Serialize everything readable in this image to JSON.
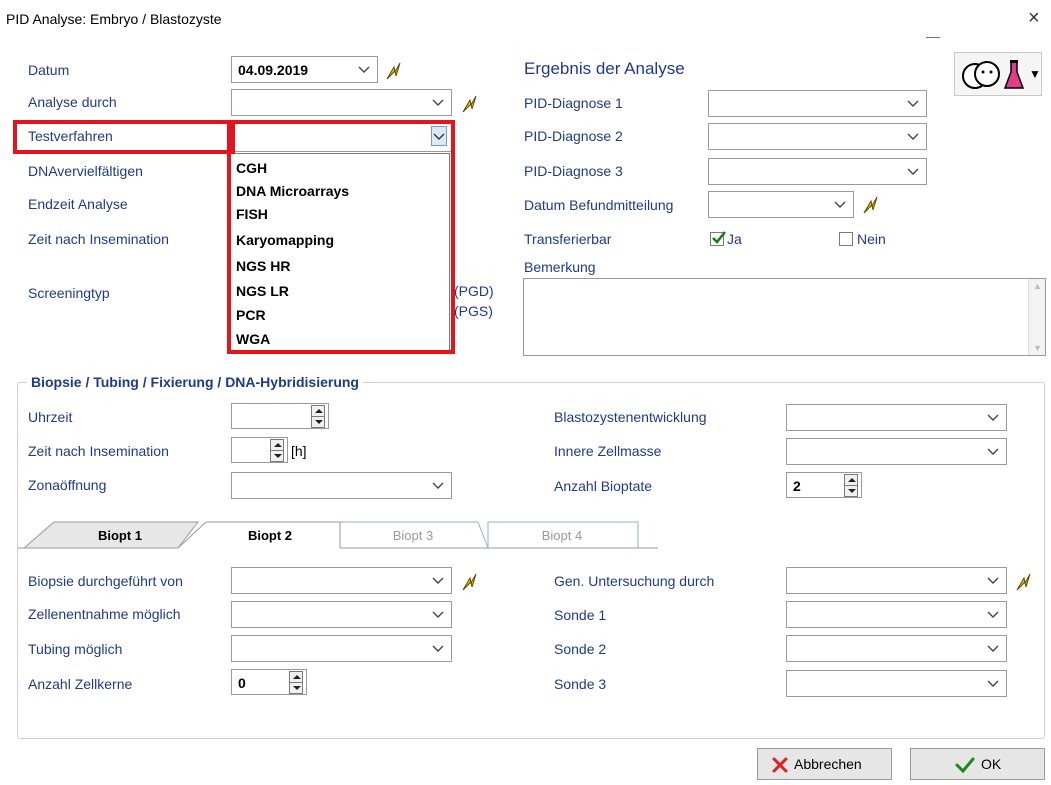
{
  "window": {
    "title": "PID Analyse: Embryo / Blastozyste",
    "close_glyph": "×",
    "minimize_glyph": "—"
  },
  "top_left": {
    "datum_label": "Datum",
    "datum_value": "04.09.2019",
    "analyse_durch_label": "Analyse durch",
    "testverfahren_label": "Testverfahren",
    "dna_label": "DNAvervielfältigen",
    "endzeit_label": "Endzeit Analyse",
    "zeit_nach_label": "Zeit nach Insemination",
    "screeningtyp_label": "Screeningtyp",
    "pgd_label": "(PGD)",
    "pgs_label": "(PGS)"
  },
  "testverfahren_dropdown": {
    "items": [
      "CGH",
      "DNA Microarrays",
      "FISH",
      "Karyomapping",
      "NGS HR",
      "NGS LR",
      "PCR",
      "WGA"
    ]
  },
  "ergebnis": {
    "heading": "Ergebnis der Analyse",
    "diag1_label": "PID-Diagnose 1",
    "diag2_label": "PID-Diagnose 2",
    "diag3_label": "PID-Diagnose 3",
    "befund_label": "Datum Befundmitteilung",
    "transfer_label": "Transferierbar",
    "ja_label": "Ja",
    "nein_label": "Nein",
    "bemerkung_label": "Bemerkung"
  },
  "biopsie_group": {
    "title": "Biopsie / Tubing / Fixierung / DNA-Hybridisierung",
    "uhrzeit_label": "Uhrzeit",
    "zeit_label": "Zeit nach Insemination",
    "unit_h": "[h]",
    "zona_label": "Zonaöffnung",
    "blasto_label": "Blastozystenentwicklung",
    "innere_label": "Innere Zellmasse",
    "anzahl_bioptate_label": "Anzahl Bioptate",
    "anzahl_bioptate_value": "2"
  },
  "tabs": [
    {
      "label": "Biopt 1",
      "state": "inactive"
    },
    {
      "label": "Biopt 2",
      "state": "active"
    },
    {
      "label": "Biopt 3",
      "state": "disabled"
    },
    {
      "label": "Biopt 4",
      "state": "disabled"
    }
  ],
  "biopt_panel": {
    "biopsie_von_label": "Biopsie durchgeführt von",
    "zellen_label": "Zellenentnahme möglich",
    "tubing_label": "Tubing möglich",
    "anzahl_zellkerne_label": "Anzahl Zellkerne",
    "anzahl_zellkerne_value": "0",
    "gen_label": "Gen. Untersuchung durch",
    "sonde1_label": "Sonde 1",
    "sonde2_label": "Sonde 2",
    "sonde3_label": "Sonde 3"
  },
  "footer": {
    "cancel_label": "Abbrechen",
    "ok_label": "OK"
  },
  "colors": {
    "label_blue": "#1f3a8a",
    "highlight_red": "#e3141c",
    "bolt_yellow": "#e9c400"
  }
}
